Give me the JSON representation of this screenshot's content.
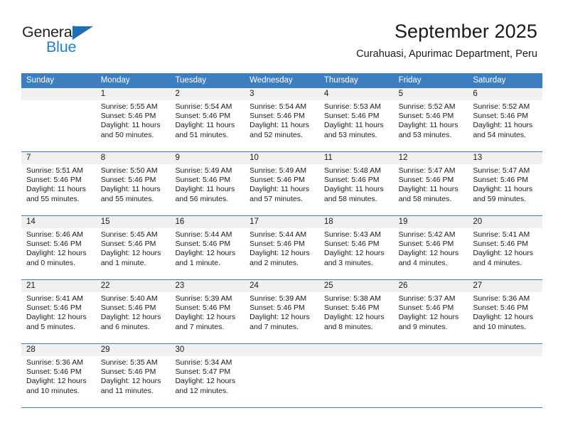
{
  "brand": {
    "name_top": "General",
    "name_bottom": "Blue",
    "triangle_icon": "triangle-icon",
    "color_dark": "#231f20",
    "color_blue": "#1f7fd4"
  },
  "header": {
    "title": "September 2025",
    "subtitle": "Curahuasi, Apurimac Department, Peru"
  },
  "theme": {
    "header_blue": "#3c7ebf",
    "daynum_band": "#f0f0f0",
    "cell_bg": "#ffffff",
    "text": "#1a1a1a"
  },
  "calendar": {
    "weekdays": [
      "Sunday",
      "Monday",
      "Tuesday",
      "Wednesday",
      "Thursday",
      "Friday",
      "Saturday"
    ],
    "weeks": [
      [
        {
          "day": "",
          "lines": []
        },
        {
          "day": "1",
          "lines": [
            "Sunrise: 5:55 AM",
            "Sunset: 5:46 PM",
            "Daylight: 11 hours",
            "and 50 minutes."
          ]
        },
        {
          "day": "2",
          "lines": [
            "Sunrise: 5:54 AM",
            "Sunset: 5:46 PM",
            "Daylight: 11 hours",
            "and 51 minutes."
          ]
        },
        {
          "day": "3",
          "lines": [
            "Sunrise: 5:54 AM",
            "Sunset: 5:46 PM",
            "Daylight: 11 hours",
            "and 52 minutes."
          ]
        },
        {
          "day": "4",
          "lines": [
            "Sunrise: 5:53 AM",
            "Sunset: 5:46 PM",
            "Daylight: 11 hours",
            "and 53 minutes."
          ]
        },
        {
          "day": "5",
          "lines": [
            "Sunrise: 5:52 AM",
            "Sunset: 5:46 PM",
            "Daylight: 11 hours",
            "and 53 minutes."
          ]
        },
        {
          "day": "6",
          "lines": [
            "Sunrise: 5:52 AM",
            "Sunset: 5:46 PM",
            "Daylight: 11 hours",
            "and 54 minutes."
          ]
        }
      ],
      [
        {
          "day": "7",
          "lines": [
            "Sunrise: 5:51 AM",
            "Sunset: 5:46 PM",
            "Daylight: 11 hours",
            "and 55 minutes."
          ]
        },
        {
          "day": "8",
          "lines": [
            "Sunrise: 5:50 AM",
            "Sunset: 5:46 PM",
            "Daylight: 11 hours",
            "and 55 minutes."
          ]
        },
        {
          "day": "9",
          "lines": [
            "Sunrise: 5:49 AM",
            "Sunset: 5:46 PM",
            "Daylight: 11 hours",
            "and 56 minutes."
          ]
        },
        {
          "day": "10",
          "lines": [
            "Sunrise: 5:49 AM",
            "Sunset: 5:46 PM",
            "Daylight: 11 hours",
            "and 57 minutes."
          ]
        },
        {
          "day": "11",
          "lines": [
            "Sunrise: 5:48 AM",
            "Sunset: 5:46 PM",
            "Daylight: 11 hours",
            "and 58 minutes."
          ]
        },
        {
          "day": "12",
          "lines": [
            "Sunrise: 5:47 AM",
            "Sunset: 5:46 PM",
            "Daylight: 11 hours",
            "and 58 minutes."
          ]
        },
        {
          "day": "13",
          "lines": [
            "Sunrise: 5:47 AM",
            "Sunset: 5:46 PM",
            "Daylight: 11 hours",
            "and 59 minutes."
          ]
        }
      ],
      [
        {
          "day": "14",
          "lines": [
            "Sunrise: 5:46 AM",
            "Sunset: 5:46 PM",
            "Daylight: 12 hours",
            "and 0 minutes."
          ]
        },
        {
          "day": "15",
          "lines": [
            "Sunrise: 5:45 AM",
            "Sunset: 5:46 PM",
            "Daylight: 12 hours",
            "and 1 minute."
          ]
        },
        {
          "day": "16",
          "lines": [
            "Sunrise: 5:44 AM",
            "Sunset: 5:46 PM",
            "Daylight: 12 hours",
            "and 1 minute."
          ]
        },
        {
          "day": "17",
          "lines": [
            "Sunrise: 5:44 AM",
            "Sunset: 5:46 PM",
            "Daylight: 12 hours",
            "and 2 minutes."
          ]
        },
        {
          "day": "18",
          "lines": [
            "Sunrise: 5:43 AM",
            "Sunset: 5:46 PM",
            "Daylight: 12 hours",
            "and 3 minutes."
          ]
        },
        {
          "day": "19",
          "lines": [
            "Sunrise: 5:42 AM",
            "Sunset: 5:46 PM",
            "Daylight: 12 hours",
            "and 4 minutes."
          ]
        },
        {
          "day": "20",
          "lines": [
            "Sunrise: 5:41 AM",
            "Sunset: 5:46 PM",
            "Daylight: 12 hours",
            "and 4 minutes."
          ]
        }
      ],
      [
        {
          "day": "21",
          "lines": [
            "Sunrise: 5:41 AM",
            "Sunset: 5:46 PM",
            "Daylight: 12 hours",
            "and 5 minutes."
          ]
        },
        {
          "day": "22",
          "lines": [
            "Sunrise: 5:40 AM",
            "Sunset: 5:46 PM",
            "Daylight: 12 hours",
            "and 6 minutes."
          ]
        },
        {
          "day": "23",
          "lines": [
            "Sunrise: 5:39 AM",
            "Sunset: 5:46 PM",
            "Daylight: 12 hours",
            "and 7 minutes."
          ]
        },
        {
          "day": "24",
          "lines": [
            "Sunrise: 5:39 AM",
            "Sunset: 5:46 PM",
            "Daylight: 12 hours",
            "and 7 minutes."
          ]
        },
        {
          "day": "25",
          "lines": [
            "Sunrise: 5:38 AM",
            "Sunset: 5:46 PM",
            "Daylight: 12 hours",
            "and 8 minutes."
          ]
        },
        {
          "day": "26",
          "lines": [
            "Sunrise: 5:37 AM",
            "Sunset: 5:46 PM",
            "Daylight: 12 hours",
            "and 9 minutes."
          ]
        },
        {
          "day": "27",
          "lines": [
            "Sunrise: 5:36 AM",
            "Sunset: 5:46 PM",
            "Daylight: 12 hours",
            "and 10 minutes."
          ]
        }
      ],
      [
        {
          "day": "28",
          "lines": [
            "Sunrise: 5:36 AM",
            "Sunset: 5:46 PM",
            "Daylight: 12 hours",
            "and 10 minutes."
          ]
        },
        {
          "day": "29",
          "lines": [
            "Sunrise: 5:35 AM",
            "Sunset: 5:46 PM",
            "Daylight: 12 hours",
            "and 11 minutes."
          ]
        },
        {
          "day": "30",
          "lines": [
            "Sunrise: 5:34 AM",
            "Sunset: 5:47 PM",
            "Daylight: 12 hours",
            "and 12 minutes."
          ]
        },
        {
          "day": "",
          "lines": []
        },
        {
          "day": "",
          "lines": []
        },
        {
          "day": "",
          "lines": []
        },
        {
          "day": "",
          "lines": []
        }
      ]
    ]
  }
}
